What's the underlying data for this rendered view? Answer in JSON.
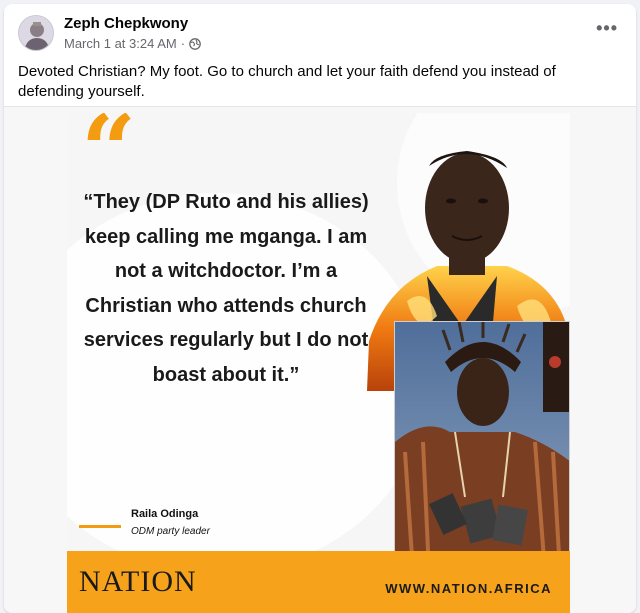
{
  "post": {
    "author": "Zeph Chepkwony",
    "timestamp": "March 1 at 3:24 AM",
    "separator": "·",
    "audience_icon": "globe-icon",
    "more_label": "•••",
    "text": "Devoted Christian? My foot. Go to church and let your faith defend you instead of defending yourself."
  },
  "card": {
    "quote_mark": "“",
    "quote": "“They (DP Ruto and his allies) keep calling me mganga. I am not a witchdoctor. I’m a Christian who attends church services regularly but I do not boast about it.”",
    "speaker_name": "Raila Odinga",
    "speaker_title": "ODM party leader",
    "brand": "NATION",
    "website": "WWW.NATION.AFRICA"
  },
  "colors": {
    "accent_orange": "#f39c12",
    "banner_orange": "#f6a21a",
    "meta_gray": "#65676b"
  }
}
